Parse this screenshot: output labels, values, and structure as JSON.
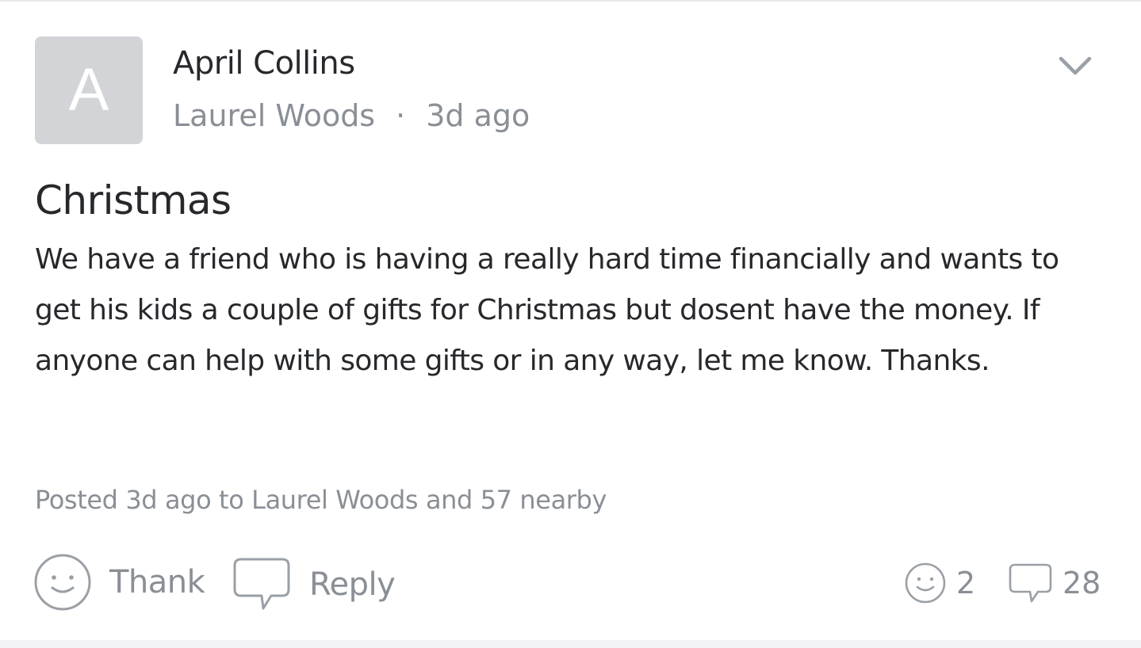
{
  "post": {
    "avatar_initial": "A",
    "author": "April Collins",
    "neighborhood": "Laurel Woods",
    "separator": "·",
    "time_ago": "3d ago",
    "title": "Christmas",
    "body": "We have a friend who is having a really hard time financially and wants to get his kids a couple of gifts for Christmas but dosent have the money. If anyone can help with some gifts or in any way, let me know. Thanks.",
    "posted_info": "Posted 3d ago to Laurel Woods and 57 nearby"
  },
  "actions": {
    "thank_label": "Thank",
    "reply_label": "Reply"
  },
  "stats": {
    "thanks_count": "2",
    "replies_count": "28"
  },
  "icons": {
    "more": "chevron-down-icon",
    "thank": "smiley-icon",
    "reply": "speech-bubble-icon"
  },
  "colors": {
    "text_primary": "#26282b",
    "text_secondary": "#8a8f96",
    "avatar_bg": "#d2d4d8"
  }
}
